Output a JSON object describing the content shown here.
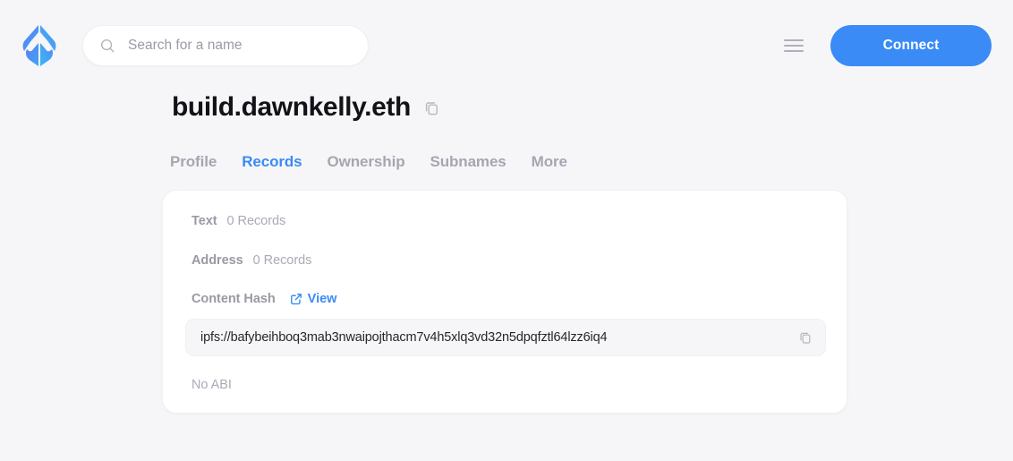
{
  "header": {
    "logo_name": "ens-logo",
    "search": {
      "placeholder": "Search for a name",
      "value": "",
      "icon": "search-icon"
    },
    "menu_icon": "hamburger-menu-icon",
    "connect_label": "Connect"
  },
  "name": {
    "title": "build.dawnkelly.eth",
    "copy_icon": "copy-icon"
  },
  "tabs": [
    {
      "label": "Profile",
      "active": false
    },
    {
      "label": "Records",
      "active": true
    },
    {
      "label": "Ownership",
      "active": false
    },
    {
      "label": "Subnames",
      "active": false
    },
    {
      "label": "More",
      "active": false
    }
  ],
  "records": {
    "text": {
      "label": "Text",
      "value": "0 Records"
    },
    "address": {
      "label": "Address",
      "value": "0 Records"
    },
    "content_hash": {
      "label": "Content Hash",
      "view_label": "View",
      "view_icon": "external-link-icon",
      "hash": "ipfs://bafybeihboq3mab3nwaipojthacm7v4h5xlq3vd32n5dpqfztl64lzz6iq4",
      "copy_icon": "copy-icon"
    },
    "abi": {
      "empty_label": "No ABI"
    }
  },
  "colors": {
    "accent": "#3a8bf5",
    "page_bg": "#f6f6f9",
    "card_bg": "#ffffff",
    "muted_text": "#a9abb5",
    "field_bg": "#f6f6f8"
  }
}
